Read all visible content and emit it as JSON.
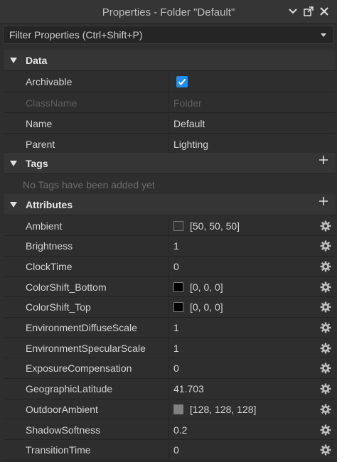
{
  "window": {
    "title": "Properties - Folder \"Default\""
  },
  "filter": {
    "placeholder": "Filter Properties (Ctrl+Shift+P)"
  },
  "sections": {
    "data": {
      "label": "Data",
      "rows": {
        "archivable": {
          "key": "Archivable",
          "checked": true
        },
        "classname": {
          "key": "ClassName",
          "value": "Folder"
        },
        "name": {
          "key": "Name",
          "value": "Default"
        },
        "parent": {
          "key": "Parent",
          "value": "Lighting"
        }
      }
    },
    "tags": {
      "label": "Tags",
      "empty_text": "No Tags have been added yet"
    },
    "attributes": {
      "label": "Attributes",
      "rows": [
        {
          "key": "Ambient",
          "value": "[50, 50, 50]",
          "swatch": "#323232"
        },
        {
          "key": "Brightness",
          "value": "1"
        },
        {
          "key": "ClockTime",
          "value": "0"
        },
        {
          "key": "ColorShift_Bottom",
          "value": "[0, 0, 0]",
          "swatch": "#000000"
        },
        {
          "key": "ColorShift_Top",
          "value": "[0, 0, 0]",
          "swatch": "#000000"
        },
        {
          "key": "EnvironmentDiffuseScale",
          "value": "1"
        },
        {
          "key": "EnvironmentSpecularScale",
          "value": "1"
        },
        {
          "key": "ExposureCompensation",
          "value": "0"
        },
        {
          "key": "GeographicLatitude",
          "value": "41.703"
        },
        {
          "key": "OutdoorAmbient",
          "value": "[128, 128, 128]",
          "swatch": "#808080"
        },
        {
          "key": "ShadowSoftness",
          "value": "0.2"
        },
        {
          "key": "TransitionTime",
          "value": "0"
        }
      ]
    }
  },
  "icons": {
    "collapse": "chevron-down-icon",
    "undock": "undock-icon",
    "close": "close-icon",
    "filter_dropdown": "caret-down-icon",
    "section_toggle": "triangle-down-icon",
    "add": "plus-icon",
    "settings": "gear-icon",
    "checkbox": "check-icon"
  },
  "colors": {
    "accent": "#1f8ef2",
    "background": "#2e2e2e",
    "header": "#353535"
  }
}
